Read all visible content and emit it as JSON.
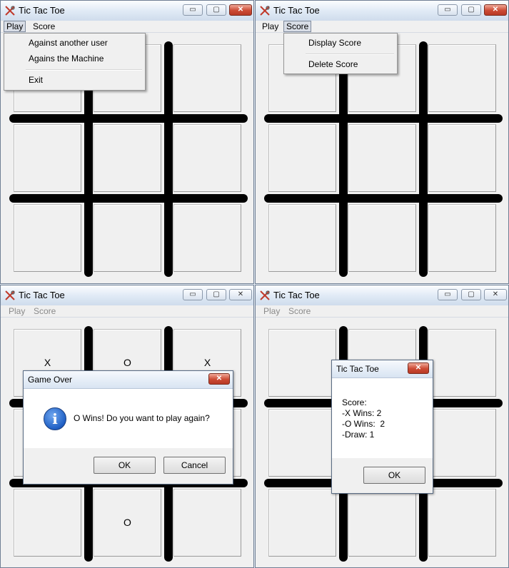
{
  "app": {
    "title": "Tic Tac Toe"
  },
  "menu": {
    "play": "Play",
    "score": "Score"
  },
  "play_menu": {
    "items": [
      "Against another user",
      "Agains the Machine",
      "Exit"
    ]
  },
  "score_menu": {
    "items": [
      "Display Score",
      "Delete Score"
    ]
  },
  "window_controls": {
    "minimize": "▭",
    "maximize": "▢",
    "close": "✕"
  },
  "game_over_board": {
    "marks": [
      "X",
      "O",
      "X",
      "",
      "",
      "",
      "",
      "O",
      ""
    ]
  },
  "game_over_dialog": {
    "title": "Game Over",
    "message": "O Wins! Do you want to play again?",
    "icon": "info-icon",
    "ok": "OK",
    "cancel": "Cancel"
  },
  "score_dialog": {
    "title": "Tic Tac Toe",
    "lines": [
      "Score:",
      "-X Wins: 2",
      "-O Wins:  2",
      "-Draw: 1"
    ],
    "ok": "OK"
  },
  "colors": {
    "close_button": "#c8462f",
    "board_lines": "#000000"
  }
}
